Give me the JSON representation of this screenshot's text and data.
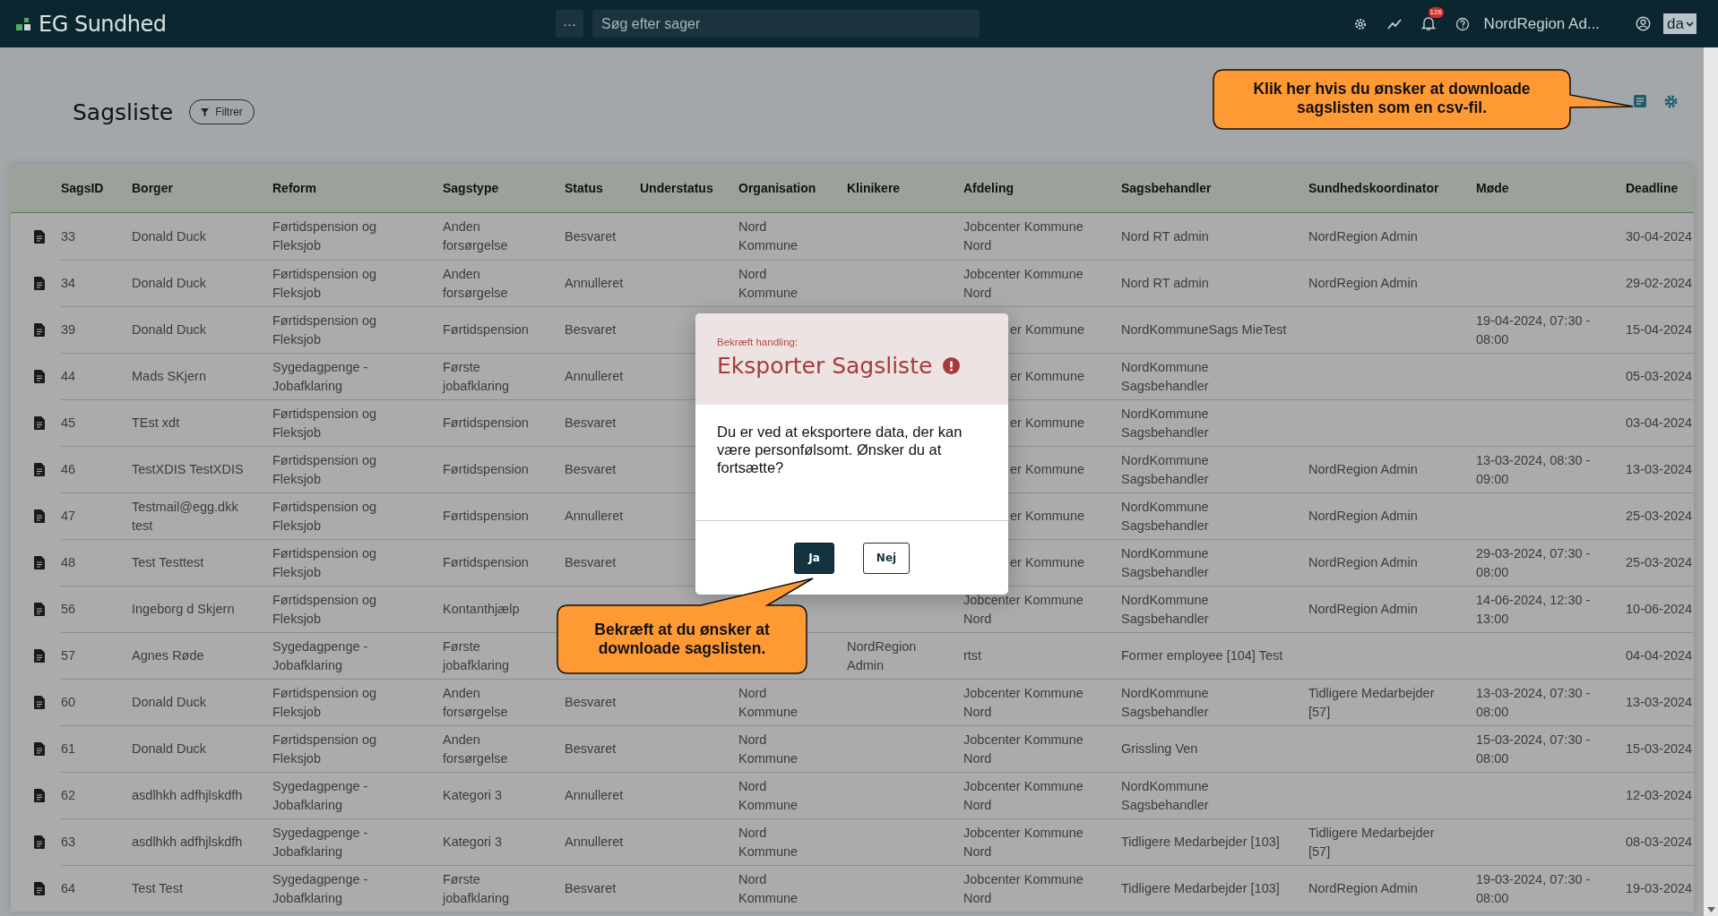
{
  "header": {
    "logo": "EG Sundhed",
    "more_button": "···",
    "search": {
      "placeholder": "Søg efter sager"
    },
    "notification_count": "126",
    "user": "NordRegion Ad...",
    "language": "da"
  },
  "page": {
    "title": "Sagsliste",
    "filter_button": "Filtrer"
  },
  "table": {
    "columns": [
      "SagsID",
      "Borger",
      "Reform",
      "Sagstype",
      "Status",
      "Understatus",
      "Organisation",
      "Klinikere",
      "Afdeling",
      "Sagsbehandler",
      "Sundhedskoordinator",
      "Møde",
      "Deadline"
    ],
    "rows": [
      {
        "cells": [
          "33",
          "Donald Duck",
          "Førtidspension og\nFleksjob",
          "Anden\nforsørgelse",
          "Besvaret",
          null,
          "Nord\nKommune",
          null,
          "Jobcenter Kommune\nNord",
          "Nord RT admin",
          "NordRegion Admin",
          null,
          "30-04-2024"
        ]
      },
      {
        "cells": [
          "34",
          "Donald Duck",
          "Førtidspension og\nFleksjob",
          "Anden\nforsørgelse",
          "Annulleret",
          null,
          "Nord\nKommune",
          null,
          "Jobcenter Kommune\nNord",
          "Nord RT admin",
          "NordRegion Admin",
          null,
          "29-02-2024"
        ]
      },
      {
        "cells": [
          "39",
          "Donald Duck",
          "Førtidspension og\nFleksjob",
          "Førtidspension",
          "Besvaret",
          null,
          null,
          null,
          {
            "text": "er Kommune",
            "cut": true
          },
          "NordKommuneSags MieTest",
          null,
          "19-04-2024, 07:30 -\n08:00",
          "15-04-2024"
        ]
      },
      {
        "cells": [
          "44",
          "Mads SKjern",
          "Sygedagpenge -\nJobafklaring",
          "Første\njobafklaring",
          "Annulleret",
          null,
          null,
          null,
          {
            "text": "er Kommune",
            "cut": true
          },
          "NordKommune\nSagsbehandler",
          null,
          null,
          "05-03-2024"
        ]
      },
      {
        "cells": [
          "45",
          "TEst xdt",
          "Førtidspension og\nFleksjob",
          "Førtidspension",
          "Besvaret",
          null,
          null,
          null,
          {
            "text": "er Kommune",
            "cut": true
          },
          "NordKommune\nSagsbehandler",
          null,
          null,
          "03-04-2024"
        ]
      },
      {
        "cells": [
          "46",
          "TestXDIS TestXDIS",
          "Førtidspension og\nFleksjob",
          "Førtidspension",
          "Besvaret",
          null,
          null,
          null,
          {
            "text": "er Kommune",
            "cut": true
          },
          "NordKommune\nSagsbehandler",
          "NordRegion Admin",
          "13-03-2024, 08:30 -\n09:00",
          "13-03-2024"
        ]
      },
      {
        "cells": [
          "47",
          "Testmail@egg.dkk\ntest",
          "Førtidspension og\nFleksjob",
          "Førtidspension",
          "Annulleret",
          null,
          null,
          null,
          {
            "text": "er Kommune",
            "cut": true
          },
          "NordKommune\nSagsbehandler",
          "NordRegion Admin",
          null,
          "25-03-2024"
        ]
      },
      {
        "cells": [
          "48",
          "Test Testtest",
          "Førtidspension og\nFleksjob",
          "Førtidspension",
          "Besvaret",
          null,
          null,
          null,
          {
            "text": "er Kommune",
            "cut": true
          },
          "NordKommune\nSagsbehandler",
          "NordRegion Admin",
          "29-03-2024, 07:30 -\n08:00",
          "25-03-2024"
        ]
      },
      {
        "cells": [
          "56",
          "Ingeborg d Skjern",
          "Førtidspension og\nFleksjob",
          "Kontanthjælp",
          null,
          null,
          null,
          null,
          "Jobcenter Kommune\nNord",
          "NordKommune\nSagsbehandler",
          "NordRegion Admin",
          "14-06-2024, 12:30 -\n13:00",
          "10-06-2024"
        ]
      },
      {
        "cells": [
          "57",
          "Agnes Røde",
          "Sygedagpenge -\nJobafklaring",
          "Første\njobafklaring",
          null,
          null,
          null,
          "NordRegion\nAdmin",
          "rtst",
          "Former employee [104] Test",
          null,
          null,
          "04-04-2024"
        ]
      },
      {
        "cells": [
          "60",
          "Donald Duck",
          "Førtidspension og\nFleksjob",
          "Anden\nforsørgelse",
          "Besvaret",
          null,
          "Nord\nKommune",
          null,
          "Jobcenter Kommune\nNord",
          "NordKommune\nSagsbehandler",
          "Tidligere Medarbejder\n[57]",
          "13-03-2024, 07:30 -\n08:00",
          "13-03-2024"
        ]
      },
      {
        "cells": [
          "61",
          "Donald Duck",
          "Førtidspension og\nFleksjob",
          "Anden\nforsørgelse",
          "Besvaret",
          null,
          "Nord\nKommune",
          null,
          "Jobcenter Kommune\nNord",
          "Grissling Ven",
          null,
          "15-03-2024, 07:30 -\n08:00",
          "15-03-2024"
        ]
      },
      {
        "cells": [
          "62",
          "asdlhkh adfhjlskdfh",
          "Sygedagpenge -\nJobafklaring",
          "Kategori 3",
          "Annulleret",
          null,
          "Nord\nKommune",
          null,
          "Jobcenter Kommune\nNord",
          "NordKommune\nSagsbehandler",
          null,
          null,
          "12-03-2024"
        ]
      },
      {
        "cells": [
          "63",
          "asdlhkh adfhjlskdfh",
          "Sygedagpenge -\nJobafklaring",
          "Kategori 3",
          "Annulleret",
          null,
          "Nord\nKommune",
          null,
          "Jobcenter Kommune\nNord",
          "Tidligere Medarbejder [103]",
          "Tidligere Medarbejder\n[57]",
          null,
          "08-03-2024"
        ]
      },
      {
        "cells": [
          "64",
          "Test Test",
          "Sygedagpenge -\nJobafklaring",
          "Første\njobafklaring",
          "Besvaret",
          null,
          "Nord\nKommune",
          null,
          "Jobcenter Kommune\nNord",
          "Tidligere Medarbejder [103]",
          "NordRegion Admin",
          "19-03-2024, 07:30 -\n08:00",
          "19-03-2024"
        ]
      }
    ]
  },
  "dialog": {
    "eyebrow": "Bekræft handling:",
    "title": "Eksporter Sagsliste",
    "message": "Du er ved at eksportere data, der kan være personfølsomt. Ønsker du at fortsætte?",
    "buttons": [
      {
        "label": "Ja",
        "kind": "primary"
      },
      {
        "label": "Nej",
        "kind": "secondary"
      }
    ]
  },
  "callouts": [
    {
      "text": "Klik her hvis du ønsker at downloade sagslisten som en csv-fil."
    },
    {
      "text": "Bekræft at du ønsker at downloade sagslisten."
    }
  ]
}
